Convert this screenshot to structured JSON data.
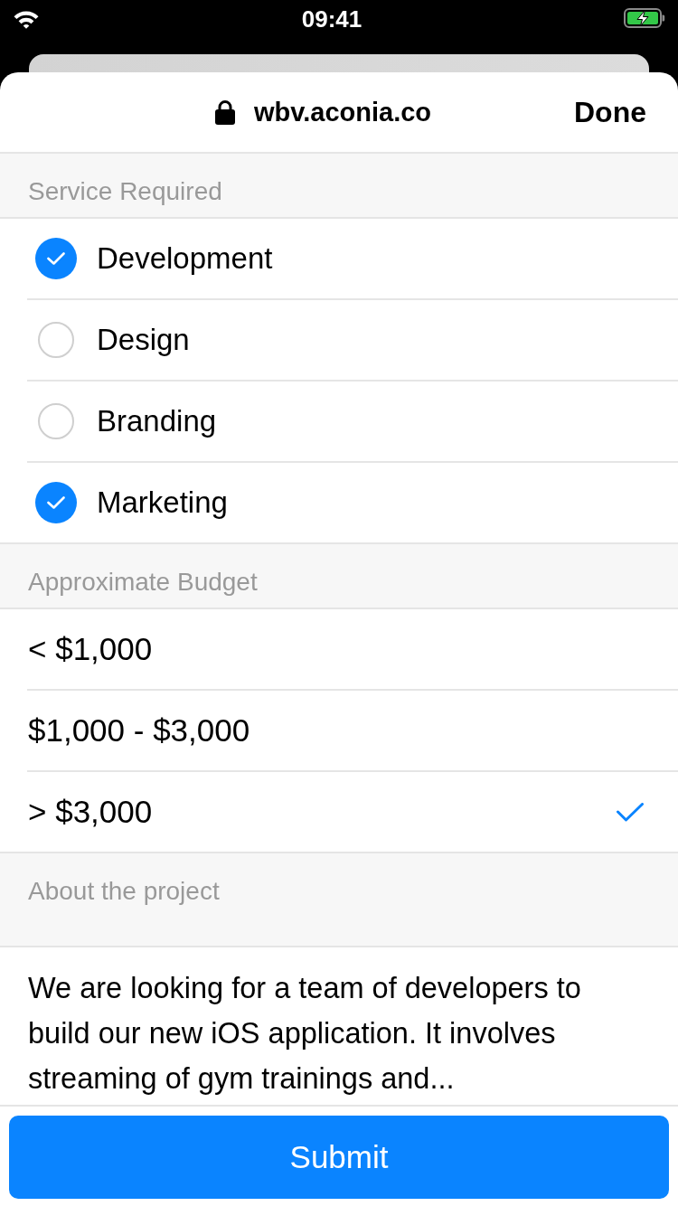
{
  "status_bar": {
    "time": "09:41"
  },
  "browser": {
    "url": "wbv.aconia.co",
    "done_label": "Done"
  },
  "sections": [
    {
      "kind": "checklist",
      "title": "Service Required",
      "items": [
        {
          "label": "Development",
          "checked": true
        },
        {
          "label": "Design",
          "checked": false
        },
        {
          "label": "Branding",
          "checked": false
        },
        {
          "label": "Marketing",
          "checked": true
        }
      ]
    },
    {
      "kind": "choice",
      "title": "Approximate Budget",
      "items": [
        {
          "label": "< $1,000",
          "selected": false
        },
        {
          "label": "$1,000 - $3,000",
          "selected": false
        },
        {
          "label": "> $3,000",
          "selected": true
        }
      ]
    },
    {
      "kind": "text",
      "title": "About the project",
      "value": "We are looking for a team of developers to build our new iOS application. It involves streaming of gym trainings and..."
    }
  ],
  "submit": {
    "label": "Submit"
  }
}
